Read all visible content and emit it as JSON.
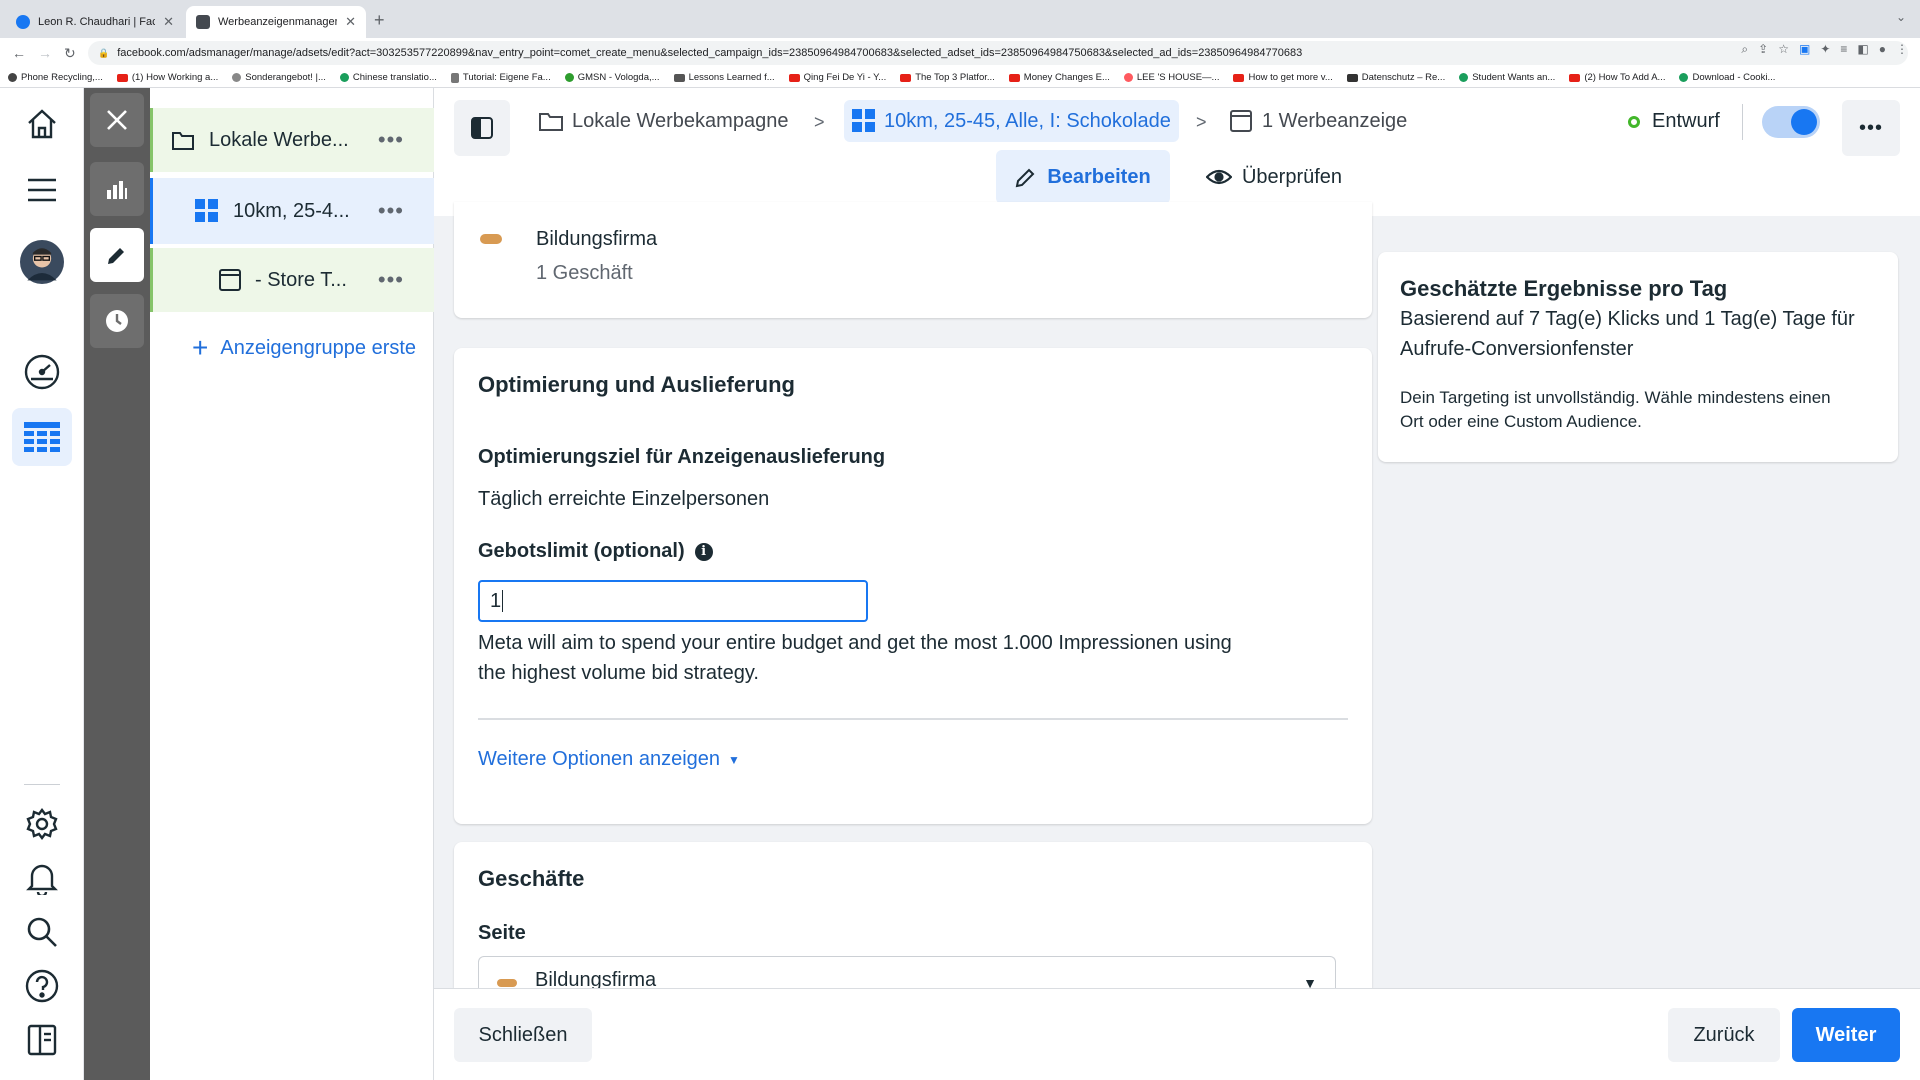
{
  "browser": {
    "tabs": [
      {
        "title": "Leon R. Chaudhari | Facebook",
        "color": "#1877f2"
      },
      {
        "title": "Werbeanzeigenmanager - Wer",
        "color": "#444950"
      }
    ],
    "url": "facebook.com/adsmanager/manage/adsets/edit?act=303253577220899&nav_entry_point=comet_create_menu&selected_campaign_ids=23850964984700683&selected_adset_ids=23850964984750683&selected_ad_ids=23850964984770683",
    "bookmarks": [
      "Phone Recycling,...",
      "(1) How Working a...",
      "Sonderangebot! |...",
      "Chinese translatio...",
      "Tutorial: Eigene Fa...",
      "GMSN - Vologda,...",
      "Lessons Learned f...",
      "Qing Fei De Yi - Y...",
      "The Top 3 Platfor...",
      "Money Changes E...",
      "LEE 'S HOUSE—...",
      "How to get more v...",
      "Datenschutz – Re...",
      "Student Wants an...",
      "(2) How To Add A...",
      "Download - Cooki..."
    ]
  },
  "tree": {
    "campaign": "Lokale Werbe...",
    "adset": "10km, 25-4...",
    "ad": "- Store T...",
    "create_adgroup": "Anzeigengruppe erste"
  },
  "header": {
    "breadcrumb_campaign": "Lokale Werbekampagne",
    "breadcrumb_adset": "10km, 25-45, Alle, I: Schokolade",
    "breadcrumb_ad": "1 Werbeanzeige",
    "status": "Entwurf",
    "status_color": "#42b72a",
    "tab_edit": "Bearbeiten",
    "tab_review": "Überprüfen"
  },
  "account_card": {
    "name": "Bildungsfirma",
    "sub": "1 Geschäft"
  },
  "optimization": {
    "title": "Optimierung und Auslieferung",
    "goal_label": "Optimierungsziel für Anzeigenauslieferung",
    "goal_value": "Täglich erreichte Einzelpersonen",
    "bid_label": "Gebotslimit (optional)",
    "bid_value": "1",
    "description_line1": "Meta will aim to spend your entire budget and get the most 1.000 Impressionen using",
    "description_line2": "the highest volume bid strategy.",
    "more_options": "Weitere Optionen anzeigen"
  },
  "business": {
    "title": "Geschäfte",
    "page_label": "Seite",
    "page_value": "Bildungsfirma"
  },
  "results": {
    "title": "Geschätzte Ergebnisse pro Tag",
    "subtitle_line1": "Basierend auf 7 Tag(e) Klicks und 1 Tag(e) Tage für",
    "subtitle_line2": "Aufrufe-Conversionfenster",
    "note_line1": "Dein Targeting ist unvollständig. Wähle mindestens einen",
    "note_line2": "Ort oder eine Custom Audience."
  },
  "footer": {
    "close": "Schließen",
    "back": "Zurück",
    "next": "Weiter"
  },
  "colors": {
    "accent": "#1877f2",
    "link": "#216fdb",
    "dark_panel": "#5b5b5b"
  }
}
